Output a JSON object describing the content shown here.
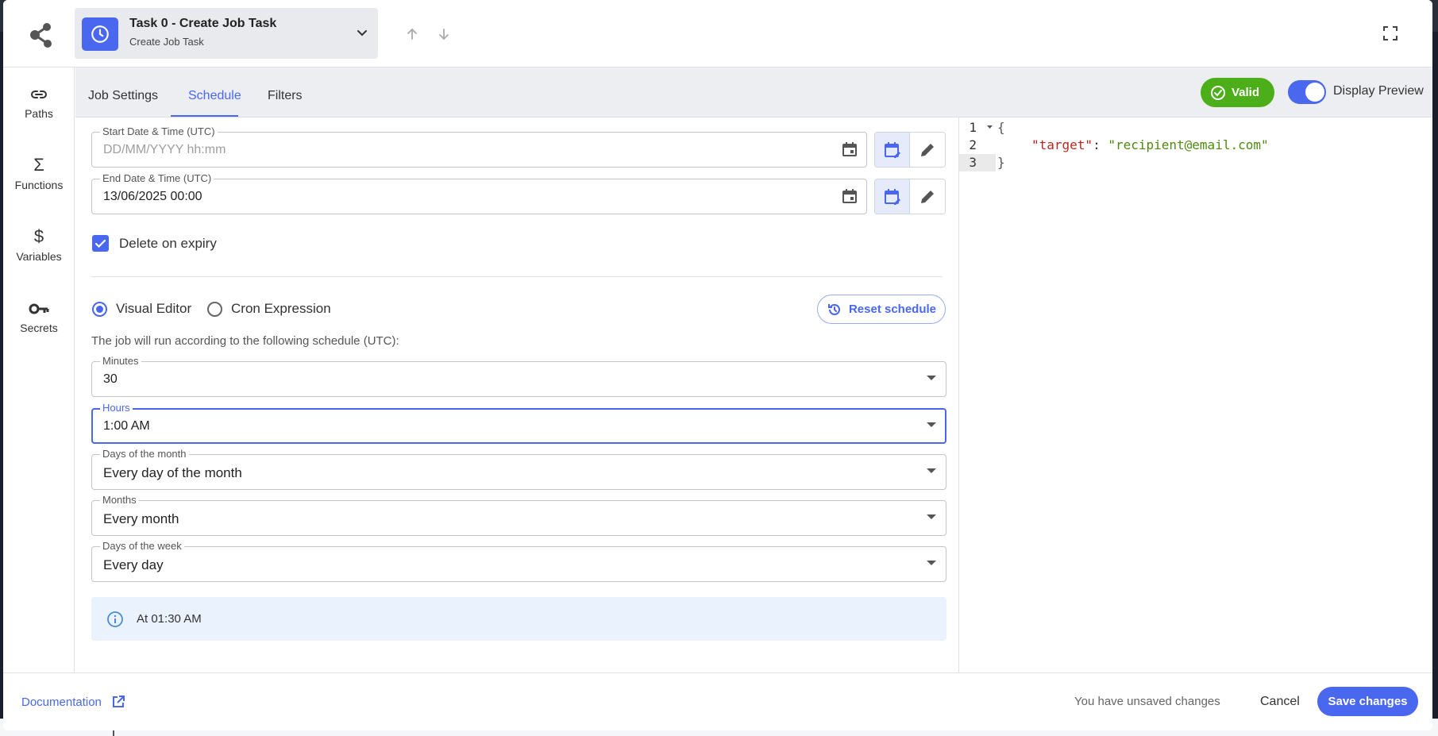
{
  "header": {
    "task_title": "Task 0 - Create Job Task",
    "task_subtitle": "Create Job Task"
  },
  "sidebar": {
    "items": [
      {
        "label": "Paths",
        "icon": "link-icon"
      },
      {
        "label": "Functions",
        "icon": "sigma-icon"
      },
      {
        "label": "Variables",
        "icon": "dollar-icon"
      },
      {
        "label": "Secrets",
        "icon": "key-icon"
      }
    ]
  },
  "tabs": [
    {
      "label": "Job Settings",
      "active": false
    },
    {
      "label": "Schedule",
      "active": true
    },
    {
      "label": "Filters",
      "active": false
    }
  ],
  "status": {
    "valid_label": "Valid",
    "display_preview_label": "Display Preview",
    "display_preview_on": true
  },
  "schedule": {
    "start": {
      "label": "Start Date & Time (UTC)",
      "placeholder": "DD/MM/YYYY hh:mm",
      "value": ""
    },
    "end": {
      "label": "End Date & Time (UTC)",
      "value": "13/06/2025 00:00"
    },
    "delete_on_expiry_label": "Delete on expiry",
    "delete_on_expiry": true,
    "mode_visual_label": "Visual Editor",
    "mode_cron_label": "Cron Expression",
    "mode_selected": "visual",
    "reset_label": "Reset schedule",
    "description": "The job will run according to the following schedule (UTC):",
    "minutes": {
      "label": "Minutes",
      "value": "30"
    },
    "hours": {
      "label": "Hours",
      "value": "1:00 AM"
    },
    "days_of_month": {
      "label": "Days of the month",
      "value": "Every day of the month"
    },
    "months": {
      "label": "Months",
      "value": "Every month"
    },
    "days_of_week": {
      "label": "Days of the week",
      "value": "Every day"
    },
    "summary": "At 01:30 AM"
  },
  "preview": {
    "line_numbers": [
      "1",
      "2",
      "3"
    ],
    "key": "\"target\"",
    "value": "\"recipient@email.com\""
  },
  "footer": {
    "documentation_label": "Documentation",
    "unsaved_label": "You have unsaved changes",
    "cancel_label": "Cancel",
    "save_label": "Save changes"
  },
  "colors": {
    "accent": "#4a67f0",
    "valid": "#4caf1a",
    "json_key": "#b52a1d",
    "json_string": "#4f8a10"
  }
}
